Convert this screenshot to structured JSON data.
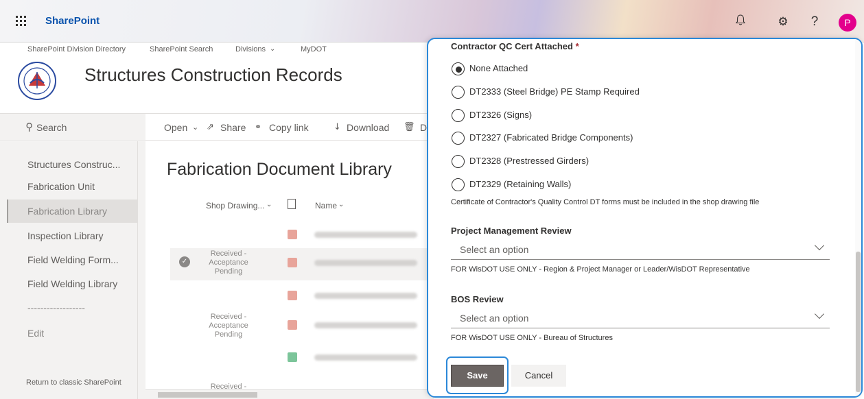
{
  "suite_bar": {
    "app_name": "SharePoint",
    "icons": [
      "waffle-icon",
      "bell-icon",
      "gear-icon",
      "help-icon"
    ],
    "avatar_initial": "P",
    "avatar_color": "#e3008c"
  },
  "hub_nav": {
    "items": [
      "SharePoint Division Directory",
      "SharePoint Search",
      "Divisions",
      "MyDOT"
    ]
  },
  "site": {
    "title": "Structures Construction Records"
  },
  "search": {
    "placeholder": "Search"
  },
  "command_bar": {
    "items": [
      "Open",
      "Share",
      "Copy link",
      "Download",
      "D"
    ]
  },
  "left_nav": {
    "items": [
      "Structures Construc...",
      "Fabrication Unit",
      "Fabrication Library",
      "Inspection Library",
      "Field Welding Form...",
      "Field Welding Library",
      "------------------",
      "Edit"
    ],
    "selected": "Fabrication Library",
    "footer": "Return to classic SharePoint"
  },
  "library": {
    "title": "Fabrication Document Library",
    "columns": [
      "Shop Drawing...",
      "Name"
    ],
    "statuses": [
      "Received - Acceptance Pending",
      "Received - Acceptance Pending",
      "Received -"
    ]
  },
  "panel": {
    "qc_cert": {
      "label": "Contractor QC Cert Attached",
      "required_mark": "*",
      "options": [
        "None Attached",
        "DT2333 (Steel Bridge) PE Stamp Required",
        "DT2326 (Signs)",
        "DT2327 (Fabricated Bridge Components)",
        "DT2328 (Prestressed Girders)",
        "DT2329 (Retaining Walls)"
      ],
      "selected": "None Attached",
      "help": "Certificate of Contractor's Quality Control DT forms must be included in the shop drawing file"
    },
    "pm_review": {
      "label": "Project Management Review",
      "placeholder": "Select an option",
      "help": "FOR WisDOT USE ONLY - Region & Project Manager or Leader/WisDOT Representative"
    },
    "bos_review": {
      "label": "BOS Review",
      "placeholder": "Select an option",
      "help": "FOR WisDOT USE ONLY - Bureau of Structures"
    },
    "save_label": "Save",
    "cancel_label": "Cancel"
  },
  "colors": {
    "accent": "#2b88d8",
    "brand_text": "#0a53ad",
    "save_button": "#6b6563"
  }
}
